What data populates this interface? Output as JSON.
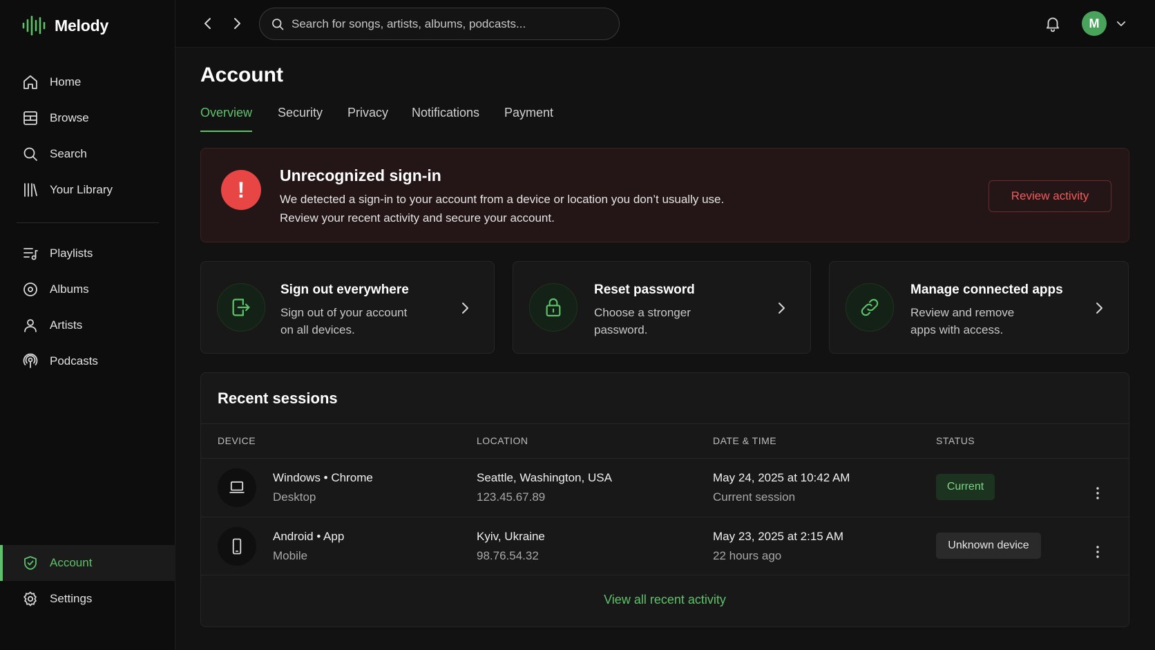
{
  "brand": {
    "name": "Melody"
  },
  "colors": {
    "accent": "#5ec26a",
    "alert": "#e84545",
    "background": "#121212"
  },
  "sidebar": {
    "primary": [
      {
        "label": "Home",
        "icon": "home-icon"
      },
      {
        "label": "Browse",
        "icon": "browse-icon"
      },
      {
        "label": "Search",
        "icon": "search-icon"
      },
      {
        "label": "Your Library",
        "icon": "library-icon"
      }
    ],
    "secondary": [
      {
        "label": "Playlists",
        "icon": "playlist-icon"
      },
      {
        "label": "Albums",
        "icon": "album-icon"
      },
      {
        "label": "Artists",
        "icon": "artist-icon"
      },
      {
        "label": "Podcasts",
        "icon": "podcast-icon"
      }
    ],
    "bottom": [
      {
        "label": "Account",
        "icon": "shield-icon",
        "active": true
      },
      {
        "label": "Settings",
        "icon": "gear-icon"
      }
    ]
  },
  "topbar": {
    "search_placeholder": "Search for songs, artists, albums, podcasts...",
    "avatar_initial": "M"
  },
  "page": {
    "title": "Account",
    "tabs": [
      {
        "label": "Overview",
        "active": true
      },
      {
        "label": "Security"
      },
      {
        "label": "Privacy"
      },
      {
        "label": "Notifications"
      },
      {
        "label": "Payment"
      }
    ]
  },
  "alert": {
    "icon_glyph": "!",
    "title": "Unrecognized sign-in",
    "line1": "We detected a sign-in to your account from a device or location you don’t usually use.",
    "line2": "Review your recent activity and secure your account.",
    "action": "Review activity"
  },
  "cards": [
    {
      "title": "Sign out everywhere",
      "desc1": "Sign out of your account",
      "desc2": "on all devices.",
      "icon": "sign-out-icon"
    },
    {
      "title": "Reset password",
      "desc1": "Choose a stronger",
      "desc2": "password.",
      "icon": "lock-icon"
    },
    {
      "title": "Manage connected apps",
      "desc1": "Review and remove",
      "desc2": "apps with access.",
      "icon": "link-icon"
    }
  ],
  "sessions": {
    "title": "Recent sessions",
    "columns": [
      "DEVICE",
      "LOCATION",
      "DATE & TIME",
      "STATUS"
    ],
    "rows": [
      {
        "device": "Windows • Chrome",
        "device_type": "Desktop",
        "device_icon": "laptop-icon",
        "location": "Seattle, Washington, USA",
        "ip": "123.45.67.89",
        "datetime": "May 24, 2025 at 10:42 AM",
        "datetime_sub": "Current session",
        "status": "Current"
      },
      {
        "device": "Android • App",
        "device_type": "Mobile",
        "device_icon": "phone-icon",
        "location": "Kyiv, Ukraine",
        "ip": "98.76.54.32",
        "datetime": "May 23, 2025 at 2:15 AM",
        "datetime_sub": "22 hours ago",
        "status": "Unknown device"
      }
    ],
    "footer_link": "View all recent activity"
  }
}
